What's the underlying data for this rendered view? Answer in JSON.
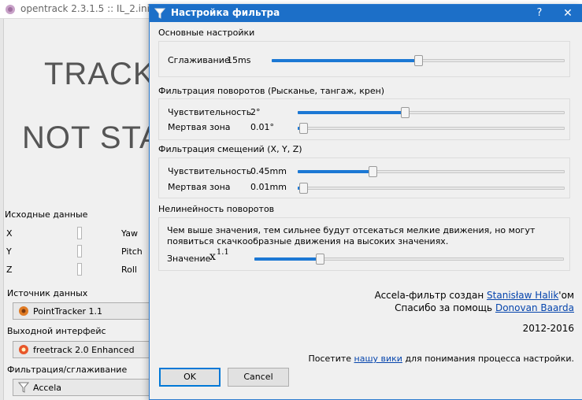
{
  "main": {
    "title": "opentrack 2.3.1.5 :: IL_2.ini",
    "status_line1": "TRACK",
    "status_line2": "NOT STA",
    "raw_data_label": "Исходные данные",
    "axes": [
      {
        "name": "X"
      },
      {
        "name": "Yaw"
      },
      {
        "name": "Y"
      },
      {
        "name": "Pitch"
      },
      {
        "name": "Z"
      },
      {
        "name": "Roll"
      }
    ],
    "source_label": "Источник данных",
    "source_value": "PointTracker 1.1",
    "output_label": "Выходной интерфейс",
    "output_value": "freetrack 2.0 Enhanced",
    "filter_label": "Фильтрация/сглаживание",
    "filter_value": "Accela"
  },
  "dialog": {
    "title": "Настройка фильтра",
    "help_label": "?",
    "close_label": "✕",
    "basic": {
      "title": "Основные настройки",
      "smoothing_label": "Сглаживание",
      "smoothing_value": "15ms",
      "smoothing_fraction": 0.5
    },
    "rotation": {
      "title": "Фильтрация поворотов (Рысканье, тангаж, крен)",
      "sensitivity_label": "Чувствительность",
      "sensitivity_value": "2°",
      "sensitivity_fraction": 0.4,
      "deadzone_label": "Мертвая зона",
      "deadzone_value": "0.01°",
      "deadzone_fraction": 0.02
    },
    "translation": {
      "title": "Фильтрация смещений (X, Y, Z)",
      "sensitivity_label": "Чувствительность",
      "sensitivity_value": "0.45mm",
      "sensitivity_fraction": 0.28,
      "deadzone_label": "Мертвая зона",
      "deadzone_value": "0.01mm",
      "deadzone_fraction": 0.02
    },
    "nonlinearity": {
      "title": "Нелинейность поворотов",
      "description": "Чем выше значения, тем сильнее будут отсекаться мелкие движения, но могут появиться скачкообразные движения на высоких значениях.",
      "value_label": "Значение",
      "exponent_base": "x",
      "exponent_power": "1.1",
      "value_fraction": 0.21
    },
    "credits": {
      "created_prefix": "Accela-фильтр создан ",
      "created_author": "Stanisław Halik",
      "created_suffix": "'ом",
      "thanks_prefix": "Спасибо за помощь ",
      "thanks_author": "Donovan Baarda",
      "years": "2012-2016",
      "visit_prefix": "Посетите ",
      "visit_link": "нашу вики",
      "visit_suffix": " для понимания процесса настройки."
    },
    "ok_label": "OK",
    "cancel_label": "Cancel"
  },
  "colors": {
    "dialog_titlebar": "#1c6fc8",
    "slider_fill": "#1c78d4",
    "link": "#0645ad"
  }
}
